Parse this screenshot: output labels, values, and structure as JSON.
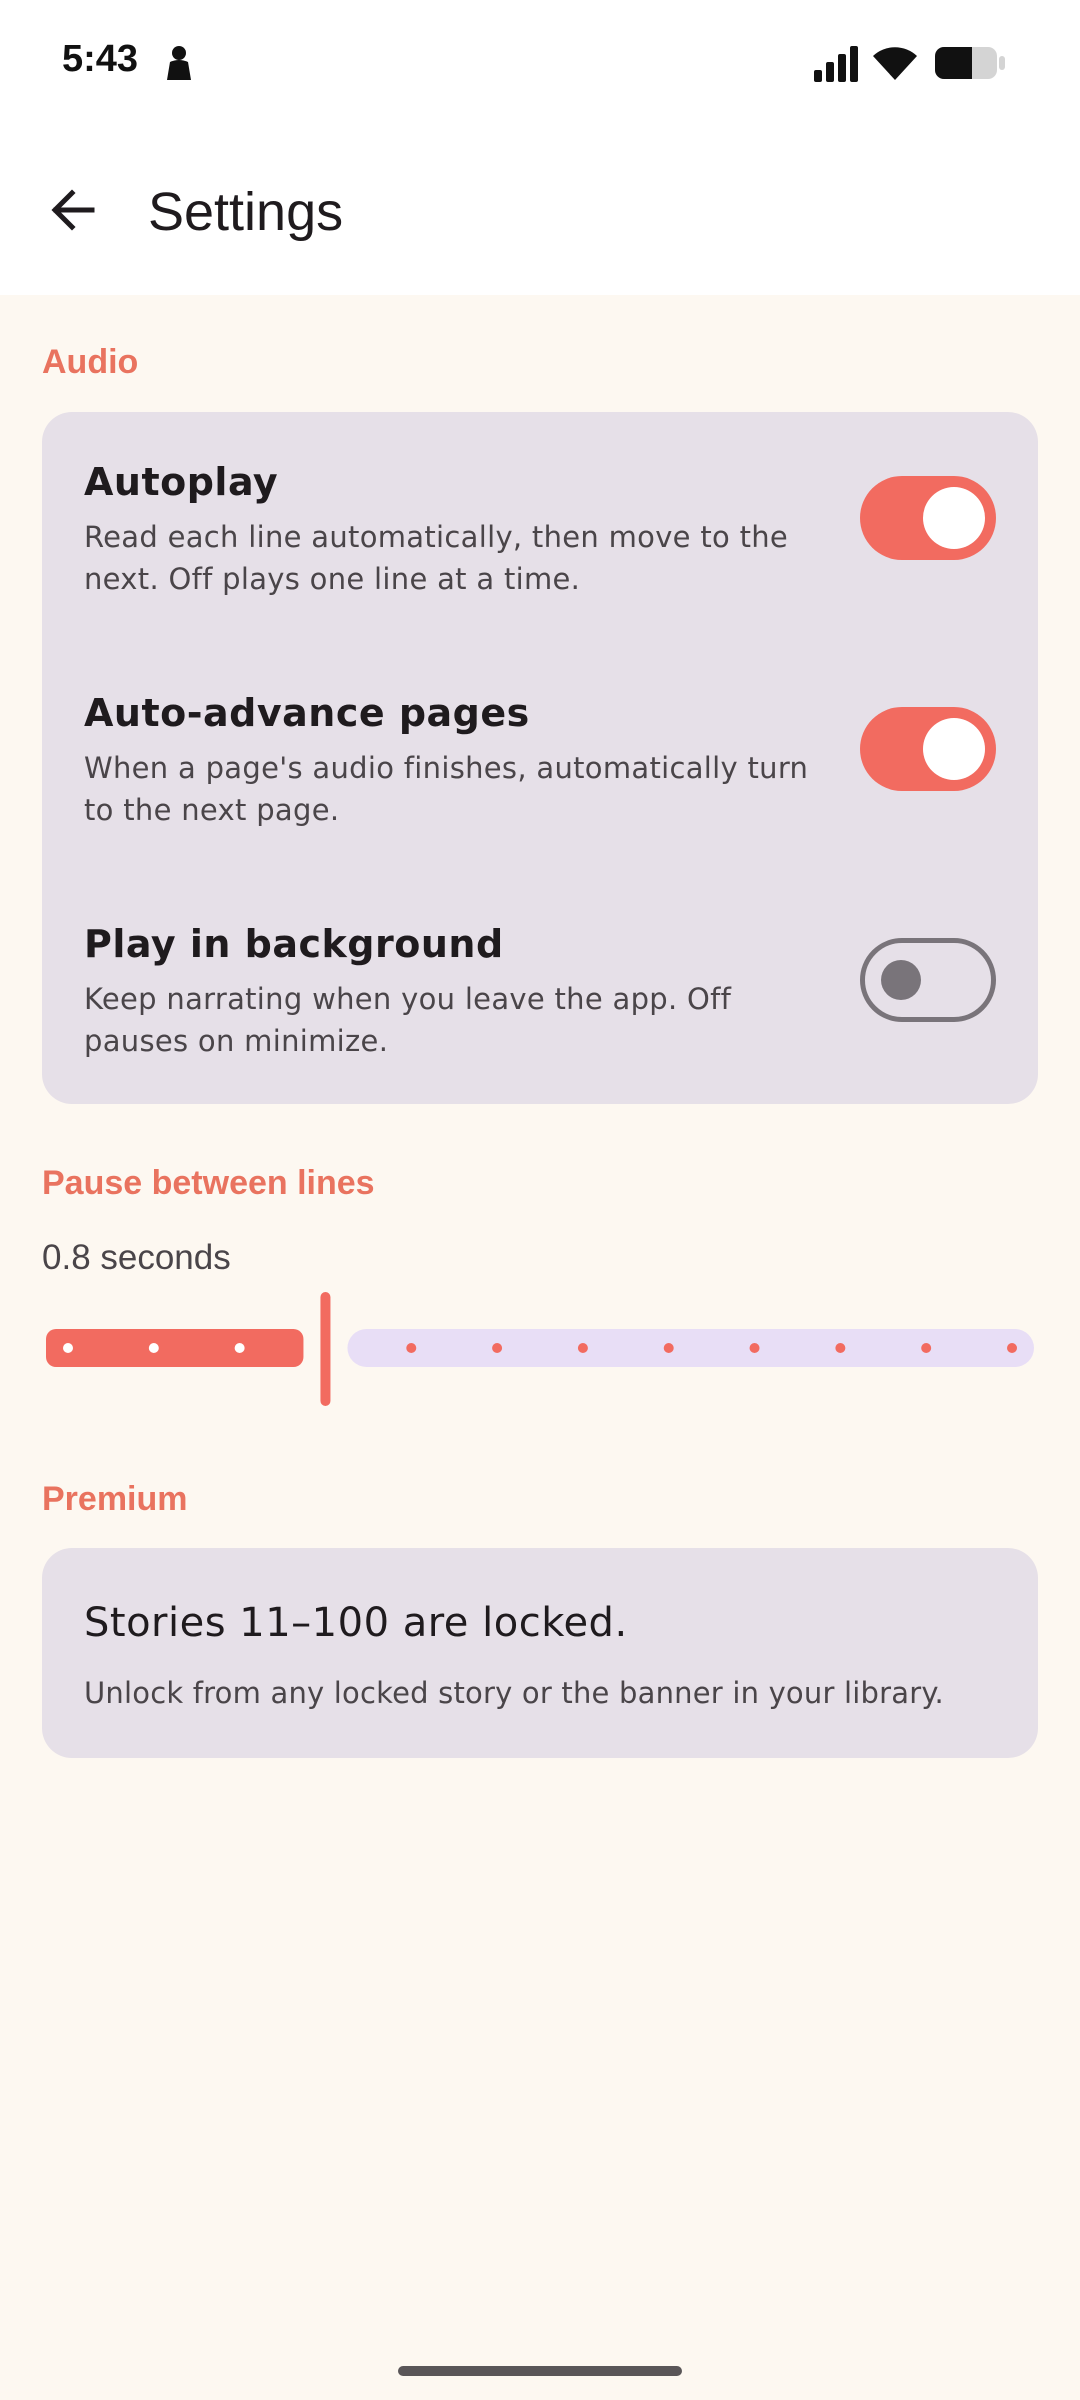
{
  "status_bar": {
    "time": "5:43",
    "icons": [
      "person-icon",
      "signal-icon",
      "wifi-icon",
      "battery-icon"
    ]
  },
  "app_bar": {
    "title": "Settings",
    "back_icon": "arrow-back-icon"
  },
  "colors": {
    "accent": "#F26B60",
    "section_label": "#E9735F",
    "card_bg": "#E6E0E8",
    "page_bg": "#FDF8F1",
    "slider_inactive": "#E8DEF6"
  },
  "audio": {
    "label": "Audio",
    "settings": [
      {
        "title": "Autoplay",
        "description": "Read each line automatically, then move to the next. Off plays one line at a time.",
        "enabled": true
      },
      {
        "title": "Auto-advance pages",
        "description": "When a page's audio finishes, automatically turn to the next page.",
        "enabled": true
      },
      {
        "title": "Play in background",
        "description": "Keep narrating when you leave the app. Off pauses on minimize.",
        "enabled": false
      }
    ]
  },
  "pause": {
    "label": "Pause between lines",
    "value_text": "0.8 seconds",
    "slider": {
      "steps": 12,
      "selected_step": 3
    }
  },
  "premium": {
    "label": "Premium",
    "title": "Stories 11–100 are locked.",
    "description": "Unlock from any locked story or the banner in your library."
  }
}
